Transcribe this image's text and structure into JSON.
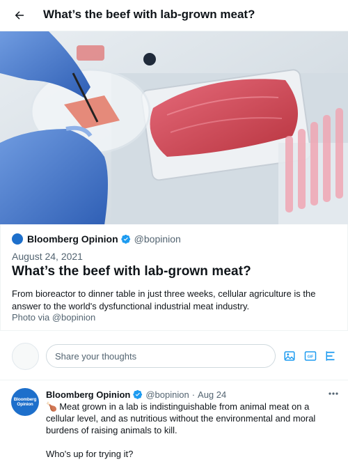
{
  "header": {
    "title": "What’s the beef with lab-grown meat?",
    "back_icon": "arrow-left-icon"
  },
  "hero": {
    "description_icon": "lab-meat-photo"
  },
  "card": {
    "author_name": "Bloomberg Opinion",
    "author_handle": "@bopinion",
    "date": "August 24, 2021",
    "title": "What’s the beef with lab-grown meat?",
    "description": "From bioreactor to dinner table in just three weeks, cellular agriculture is the answer to the world's dysfunctional industrial meat industry.",
    "credit": "Photo via @bopinion",
    "logo_text": "Bloomberg Opinion"
  },
  "compose": {
    "placeholder": "Share your thoughts",
    "tools": [
      "image-icon",
      "gif-icon",
      "poll-icon"
    ],
    "gif_label": "GIF"
  },
  "tweet": {
    "avatar_label_line1": "Bloomberg",
    "avatar_label_line2": "Opinion",
    "name": "Bloomberg Opinion",
    "handle": "@bopinion",
    "separator": "·",
    "time": "Aug 24",
    "emoji": "🍗",
    "line1": "Meat grown in a lab is indistinguishable from animal meat on a cellular level, and as nutritious without the environmental and moral burdens of raising animals to kill.",
    "line2": "Who's up for trying it?"
  },
  "colors": {
    "accent": "#1d9bf0",
    "brand_blue": "#1d6fcb",
    "text_primary": "#0f1419",
    "text_secondary": "#536471"
  }
}
